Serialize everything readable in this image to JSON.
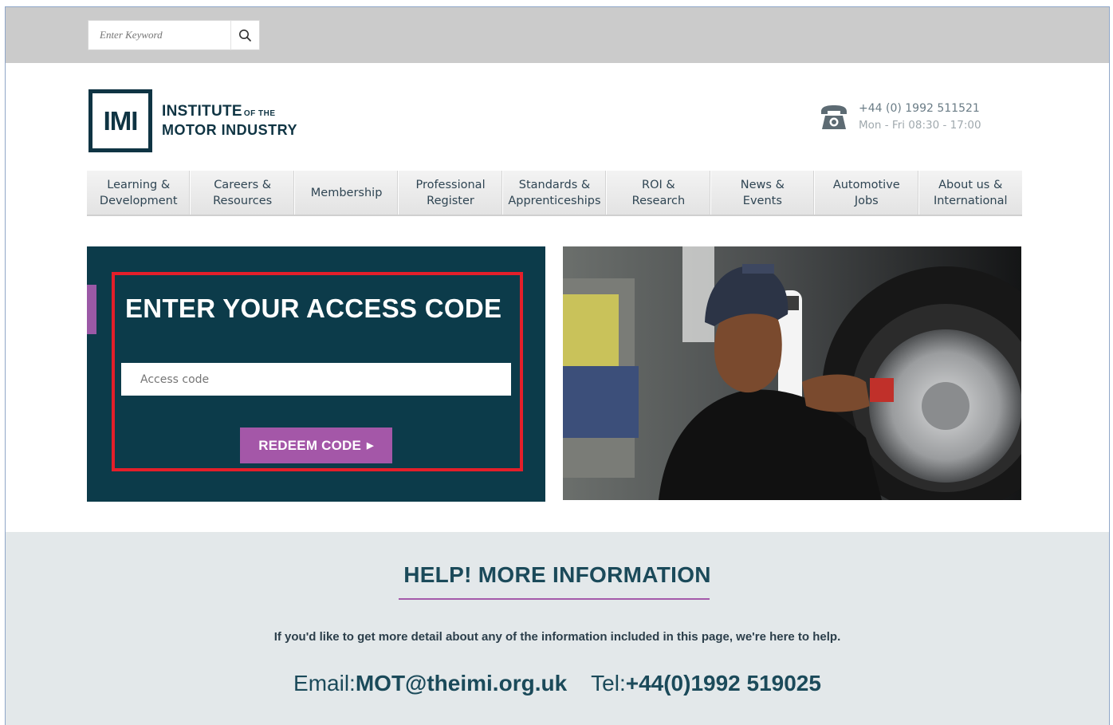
{
  "search": {
    "placeholder": "Enter Keyword"
  },
  "logo": {
    "mark": "IMI",
    "line1_main": "INSTITUTE",
    "line1_small": "OF THE",
    "line2": "MOTOR INDUSTRY"
  },
  "contact_header": {
    "phone": "+44 (0) 1992 511521",
    "hours": "Mon - Fri 08:30 - 17:00",
    "icon": "telephone-icon"
  },
  "nav": {
    "items": [
      {
        "line1": "Learning &",
        "line2": "Development"
      },
      {
        "line1": "Careers &",
        "line2": "Resources"
      },
      {
        "line1": "Membership",
        "line2": ""
      },
      {
        "line1": "Professional",
        "line2": "Register"
      },
      {
        "line1": "Standards &",
        "line2": "Apprenticeships"
      },
      {
        "line1": "ROI &",
        "line2": "Research"
      },
      {
        "line1": "News &",
        "line2": "Events"
      },
      {
        "line1": "Automotive Jobs",
        "line2": ""
      },
      {
        "line1": "About us &",
        "line2": "International"
      }
    ]
  },
  "access": {
    "title": "ENTER YOUR ACCESS CODE",
    "input_placeholder": "Access code",
    "button_label": "REDEEM CODE"
  },
  "help": {
    "title": "HELP! MORE INFORMATION",
    "text": "If you'd like to get more detail about any of the information included in this page, we're here to help.",
    "email_label": "Email:",
    "email": "MOT@theimi.org.uk",
    "tel_label": "Tel:",
    "tel": "+44(0)1992 519025"
  },
  "colors": {
    "brand_dark": "#0c3b4a",
    "accent_purple": "#a457a8",
    "highlight_red": "#e41f2a"
  }
}
